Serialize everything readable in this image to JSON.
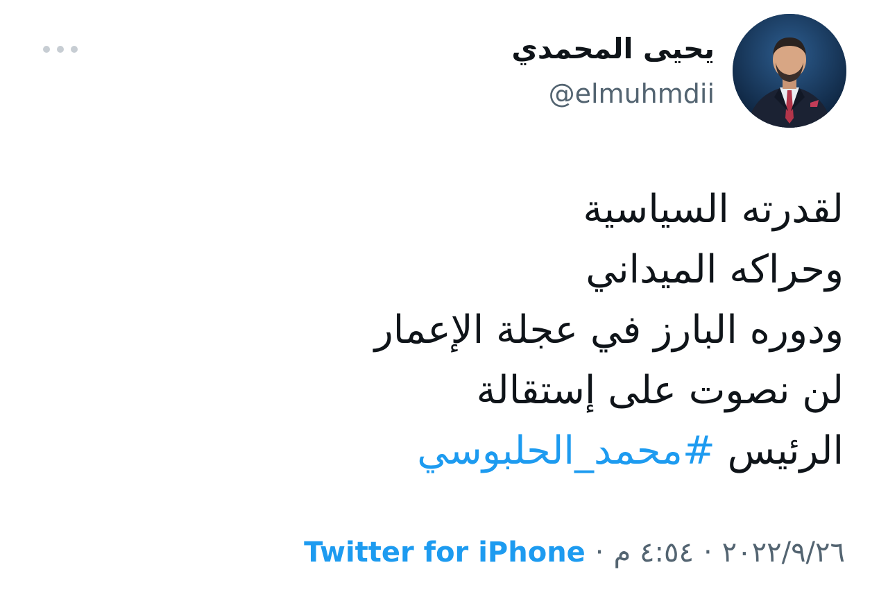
{
  "tweet": {
    "author": {
      "display_name": "يحيى المحمدي",
      "handle": "@elmuhmdii"
    },
    "text_lines": [
      "لقدرته السياسية",
      "وحراكه الميداني",
      "ودوره البارز في عجلة الإعمار",
      "لن نصوت على إستقالة"
    ],
    "last_line_prefix": "الرئيس ",
    "hashtag": "#محمد_الحلبوسي",
    "meta": {
      "date": "٢٠٢٢/٩/٢٦",
      "separator": "·",
      "time": "٤:٥٤ م",
      "source": "Twitter for iPhone"
    }
  },
  "colors": {
    "text": "#0f1419",
    "secondary": "#536471",
    "link": "#1d9bf0",
    "dots": "#c7cdd3"
  },
  "icons": {
    "more": "more-horizontal-icon"
  }
}
